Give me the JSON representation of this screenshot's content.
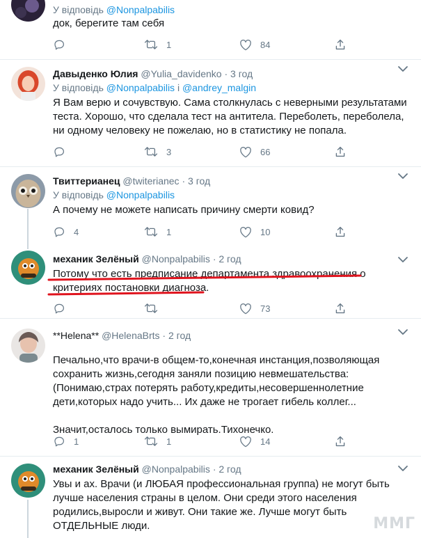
{
  "tweets": [
    {
      "reply_prefix": "У відповідь",
      "reply_to": [
        "@Nonpalpabilis"
      ],
      "lines": [
        "док, берегите там себя"
      ],
      "replies": "",
      "retweets": "1",
      "likes": "84"
    },
    {
      "name": "Давыденко Юлия",
      "handle": "@Yulia_davidenko",
      "time": "3 год",
      "reply_prefix": "У відповідь",
      "reply_to": [
        "@Nonpalpabilis",
        "@andrey_malgin"
      ],
      "reply_joiner": "і",
      "lines": [
        "Я Вам верю и сочувствую. Сама столкнулась с неверными результатами",
        "теста. Хорошо, что сделала тест на антитела. Переболеть, переболела,",
        "ни одному человеку не пожелаю, но в статистику не попала."
      ],
      "replies": "",
      "retweets": "3",
      "likes": "66"
    },
    {
      "name": "Твиттерианец",
      "handle": "@twiterianec",
      "time": "3 год",
      "reply_prefix": "У відповідь",
      "reply_to": [
        "@Nonpalpabilis"
      ],
      "lines": [
        "А почему не можете написать причину смерти ковид?"
      ],
      "replies": "4",
      "retweets": "1",
      "likes": "10"
    },
    {
      "name": "механик Зелёный",
      "handle": "@Nonpalpabilis",
      "time": "2 год",
      "lines": [
        "Потому что есть предписание департамента здравоохранения о",
        "критериях постановки диагноза."
      ],
      "replies": "",
      "retweets": "",
      "likes": "73"
    },
    {
      "name": "**Helena**",
      "handle": "@HelenaBrts",
      "time": "2 год",
      "lines": [
        "Печально,что врачи-в общем-то,конечная инстанция,позволяющая",
        "сохранить жизнь,сегодня заняли позицию невмешательства:",
        "(Понимаю,страх потерять работу,кредиты,несовершеннолетние",
        "дети,которых надо учить... Их даже не трогает гибель коллег...",
        "",
        "Значит,осталось только вымирать.Тихонечко."
      ],
      "replies": "1",
      "retweets": "1",
      "likes": "14"
    },
    {
      "name": "механик Зелёный",
      "handle": "@Nonpalpabilis",
      "time": "2 год",
      "lines": [
        "Увы и ах. Врачи (и ЛЮБАЯ профессиональная группа) не могут быть",
        "лучше населения страны в целом. Они среди этого населения",
        "родились,выросли и живут. Они такие же. Лучше могут быть",
        "ОТДЕЛЬНЫЕ люди."
      ]
    }
  ],
  "separator": "·",
  "watermark": "ММГ",
  "colors": {
    "link": "#1b95e0",
    "muted": "#657786",
    "underline": "#e0141e"
  }
}
